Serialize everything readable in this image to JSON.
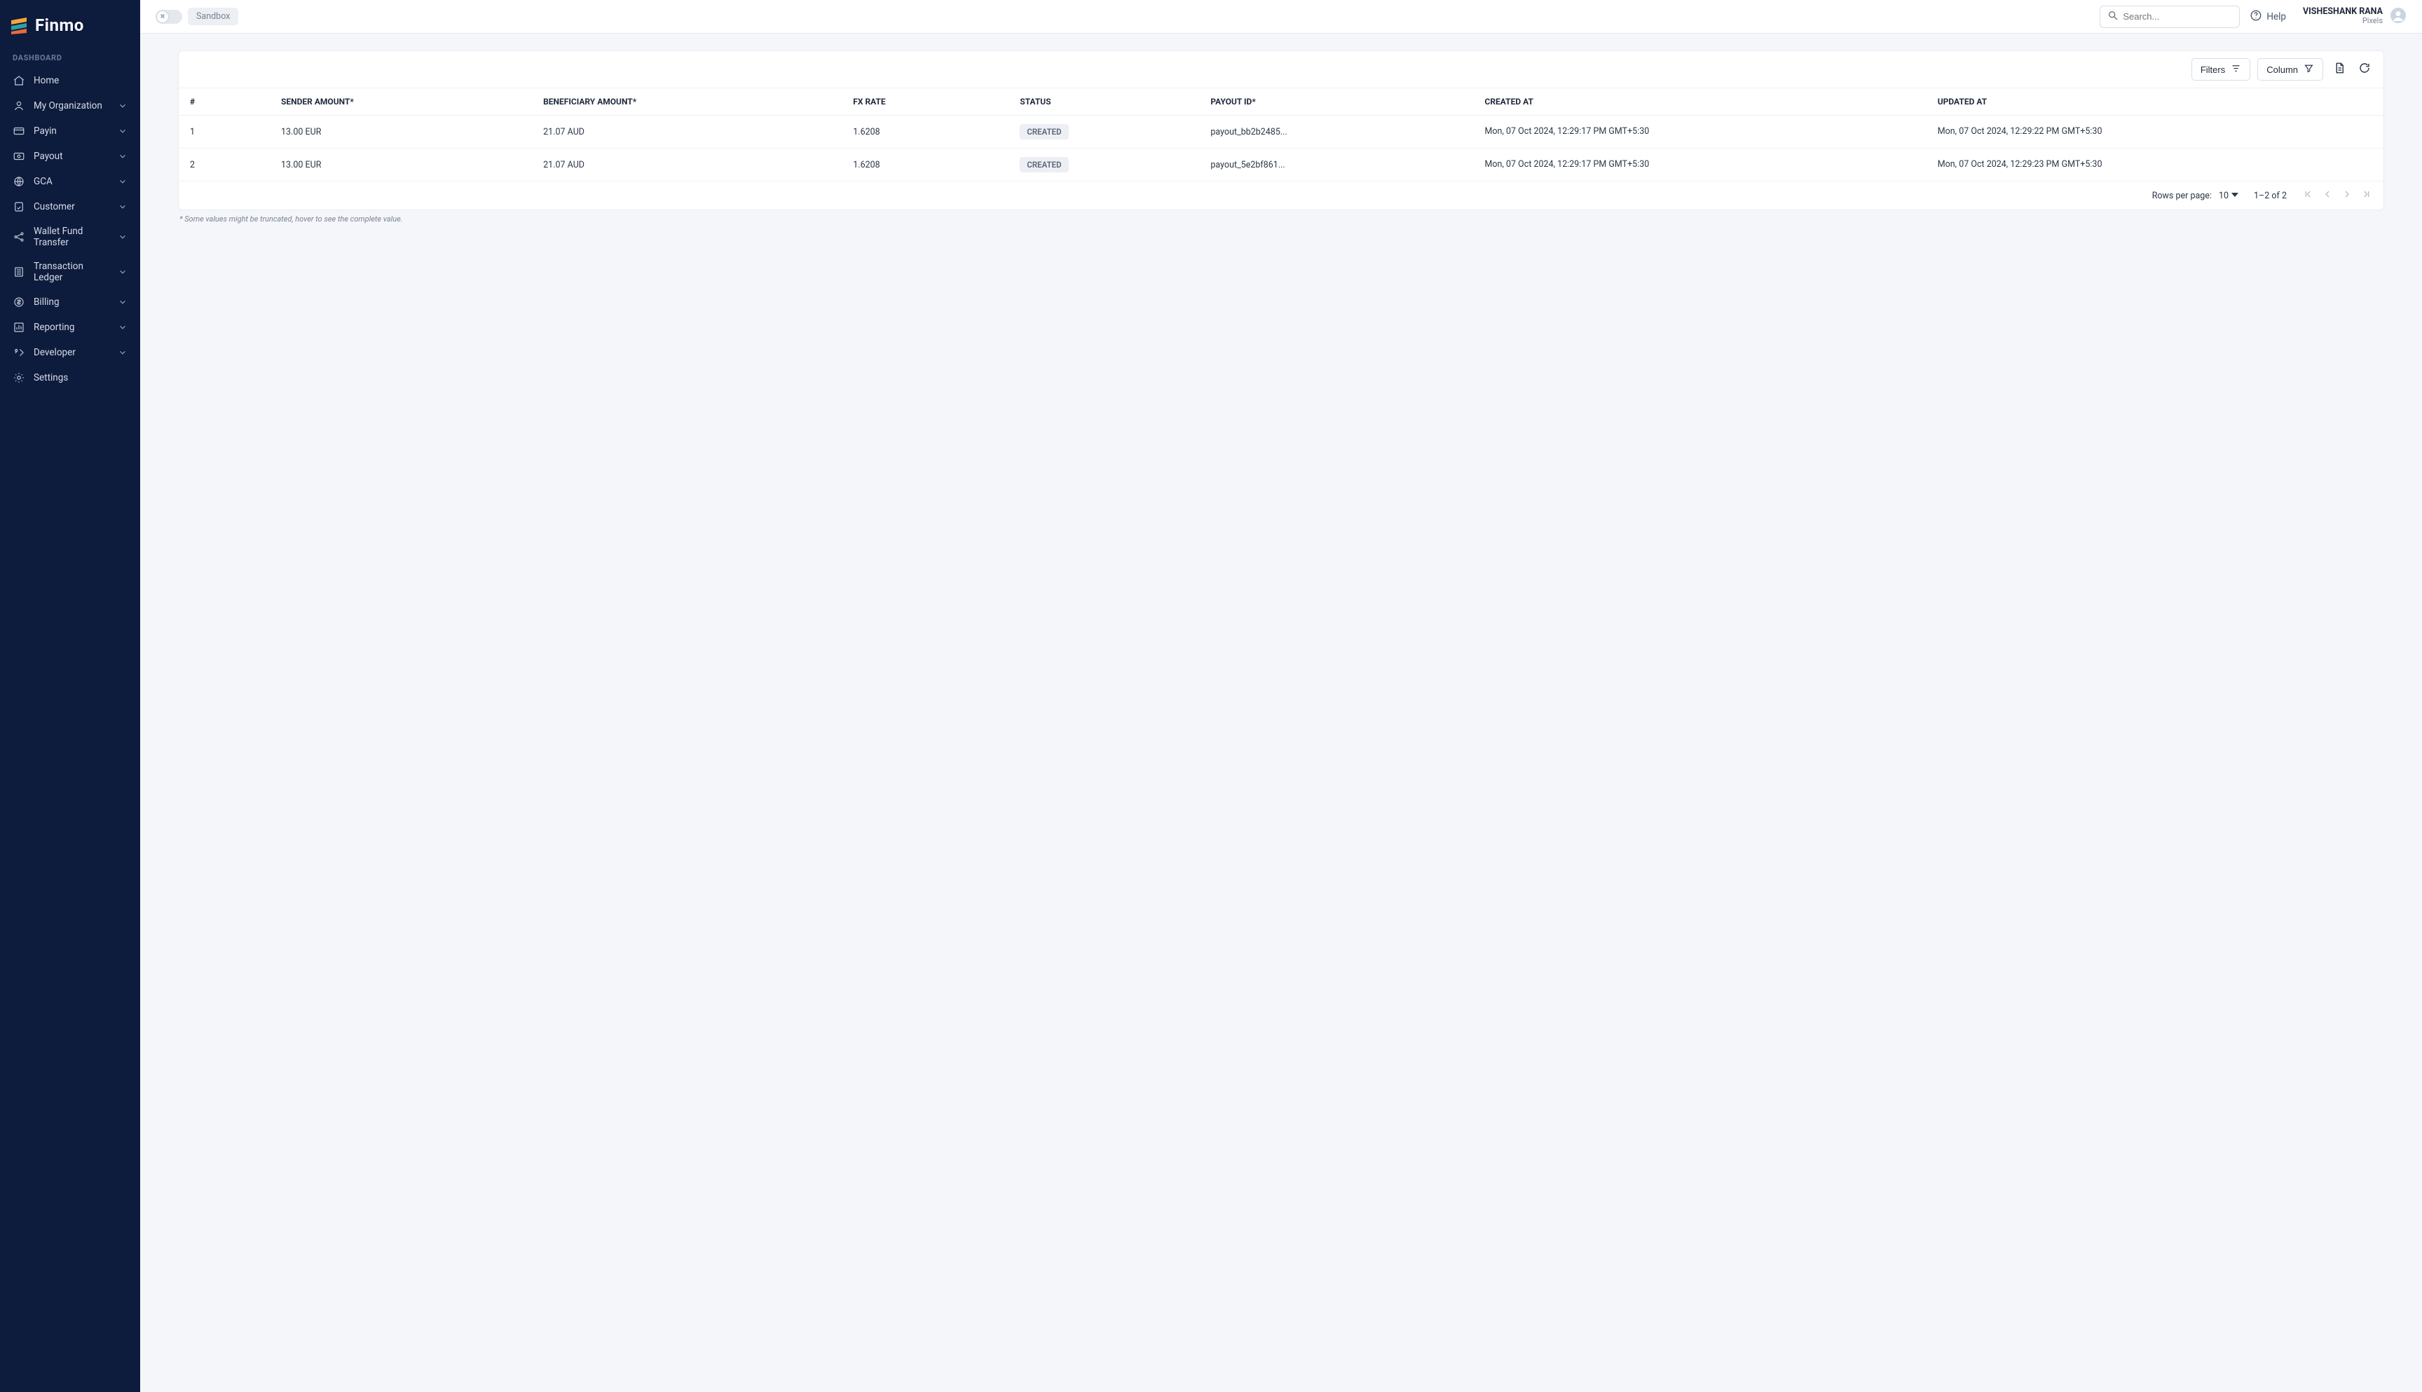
{
  "brand": {
    "name": "Finmo"
  },
  "sidebar": {
    "section_label": "DASHBOARD",
    "items": [
      {
        "label": "Home",
        "icon": "home",
        "expandable": false
      },
      {
        "label": "My Organization",
        "icon": "org",
        "expandable": true
      },
      {
        "label": "Payin",
        "icon": "card",
        "expandable": true
      },
      {
        "label": "Payout",
        "icon": "payout",
        "expandable": true
      },
      {
        "label": "GCA",
        "icon": "globe",
        "expandable": true
      },
      {
        "label": "Customer",
        "icon": "customer",
        "expandable": true
      },
      {
        "label": "Wallet Fund Transfer",
        "icon": "share",
        "expandable": true
      },
      {
        "label": "Transaction Ledger",
        "icon": "ledger",
        "expandable": true
      },
      {
        "label": "Billing",
        "icon": "billing",
        "expandable": true
      },
      {
        "label": "Reporting",
        "icon": "report",
        "expandable": true
      },
      {
        "label": "Developer",
        "icon": "dev",
        "expandable": true
      },
      {
        "label": "Settings",
        "icon": "settings",
        "expandable": false
      }
    ]
  },
  "topbar": {
    "sandbox_label": "Sandbox",
    "search_placeholder": "Search...",
    "help_label": "Help",
    "user_name": "VISHESHANK RANA",
    "user_org": "Pixels"
  },
  "toolbar": {
    "filters_label": "Filters",
    "column_label": "Column"
  },
  "table": {
    "headers": {
      "num": "#",
      "sender": "SENDER AMOUNT*",
      "beneficiary": "BENEFICIARY AMOUNT*",
      "fx": "FX RATE",
      "status": "STATUS",
      "payout_id": "PAYOUT ID*",
      "created": "CREATED AT",
      "updated": "UPDATED AT"
    },
    "rows": [
      {
        "num": "1",
        "sender": "13.00 EUR",
        "beneficiary": "21.07 AUD",
        "fx": "1.6208",
        "status": "CREATED",
        "payout_id": "payout_bb2b2485...",
        "created": "Mon, 07 Oct 2024, 12:29:17 PM GMT+5:30",
        "updated": "Mon, 07 Oct 2024, 12:29:22 PM GMT+5:30"
      },
      {
        "num": "2",
        "sender": "13.00 EUR",
        "beneficiary": "21.07 AUD",
        "fx": "1.6208",
        "status": "CREATED",
        "payout_id": "payout_5e2bf861...",
        "created": "Mon, 07 Oct 2024, 12:29:17 PM GMT+5:30",
        "updated": "Mon, 07 Oct 2024, 12:29:23 PM GMT+5:30"
      }
    ]
  },
  "pagination": {
    "rows_per_page_label": "Rows per page:",
    "rows_per_page_value": "10",
    "range_text": "1–2 of 2"
  },
  "footnote": "* Some values might be truncated, hover to see the complete value."
}
